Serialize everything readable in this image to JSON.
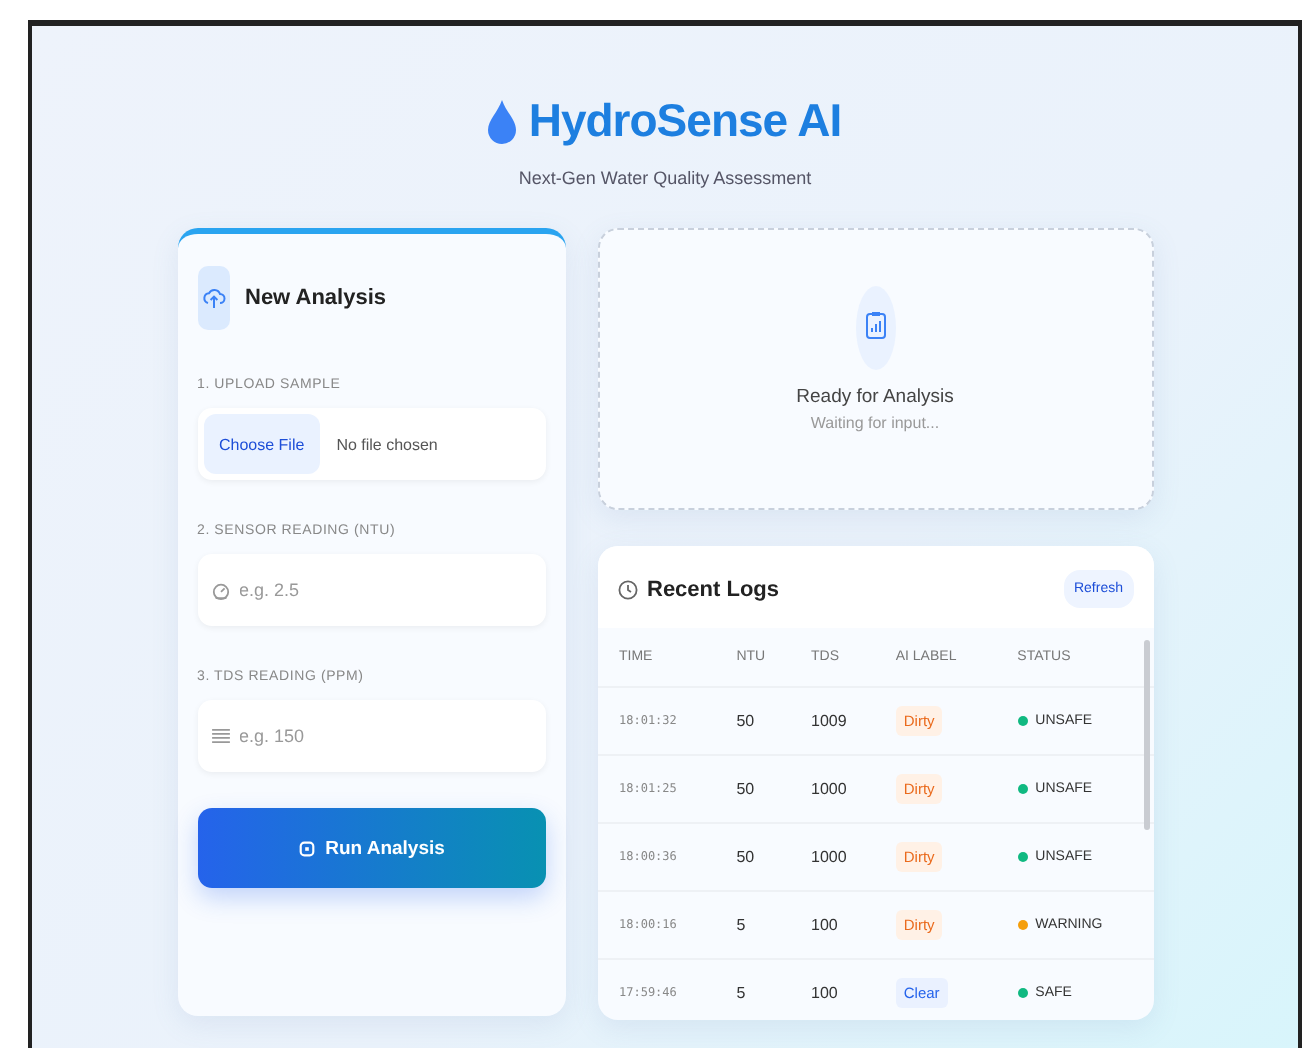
{
  "header": {
    "title": "HydroSense AI",
    "subtitle": "Next-Gen Water Quality Assessment"
  },
  "analysis_form": {
    "title": "New Analysis",
    "upload": {
      "label": "1. UPLOAD SAMPLE",
      "button": "Choose File",
      "file_status": "No file chosen"
    },
    "fields": [
      {
        "label": "2. SENSOR READING (NTU)",
        "placeholder": "e.g. 2.5",
        "kind": "gauge"
      },
      {
        "label": "3. TDS READING (PPM)",
        "placeholder": "e.g. 150",
        "kind": "lines"
      }
    ],
    "submit": "Run Analysis"
  },
  "result_panel": {
    "title": "Ready for Analysis",
    "subtitle": "Waiting for input..."
  },
  "recent_logs": {
    "title": "Recent Logs",
    "refresh": "Refresh",
    "columns": [
      "TIME",
      "NTU",
      "TDS",
      "AI LABEL",
      "STATUS"
    ],
    "rows": [
      {
        "time": "18:01:32",
        "ntu": "50",
        "tds": "1009",
        "label": "Dirty",
        "kind": "dirty",
        "status": "UNSAFE",
        "color": "#10b981"
      },
      {
        "time": "18:01:25",
        "ntu": "50",
        "tds": "1000",
        "label": "Dirty",
        "kind": "dirty",
        "status": "UNSAFE",
        "color": "#10b981"
      },
      {
        "time": "18:00:36",
        "ntu": "50",
        "tds": "1000",
        "label": "Dirty",
        "kind": "dirty",
        "status": "UNSAFE",
        "color": "#10b981"
      },
      {
        "time": "18:00:16",
        "ntu": "5",
        "tds": "100",
        "label": "Dirty",
        "kind": "dirty",
        "status": "WARNING",
        "color": "#f59e0b"
      },
      {
        "time": "17:59:46",
        "ntu": "5",
        "tds": "100",
        "label": "Clear",
        "kind": "clear",
        "status": "SAFE",
        "color": "#10b981"
      }
    ]
  }
}
